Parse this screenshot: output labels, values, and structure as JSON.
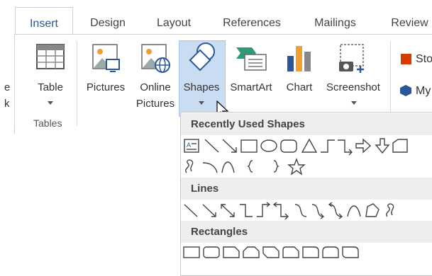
{
  "tabs": [
    "Insert",
    "Design",
    "Layout",
    "References",
    "Mailings",
    "Review"
  ],
  "active_tab": "Insert",
  "ribbon": {
    "left_partial": [
      "e",
      "k"
    ],
    "table": {
      "label": "Table"
    },
    "tables_group": "Tables",
    "pictures": {
      "label": "Pictures"
    },
    "online_pictures": {
      "line1": "Online",
      "line2": "Pictures"
    },
    "shapes": {
      "label": "Shapes"
    },
    "smartart": {
      "label": "SmartArt"
    },
    "chart": {
      "label": "Chart"
    },
    "screenshot": {
      "label": "Screenshot"
    },
    "store_partial": "Sto",
    "my_addins_partial": "My"
  },
  "dropdown": {
    "recent_title": "Recently Used Shapes",
    "lines_title": "Lines",
    "rectangles_title": "Rectangles"
  },
  "colors": {
    "accent": "#2b579a",
    "highlight": "#c9dcf2",
    "section_bg": "#eeeeee",
    "store_red": "#d83b01",
    "addin_blue": "#2b579a"
  }
}
